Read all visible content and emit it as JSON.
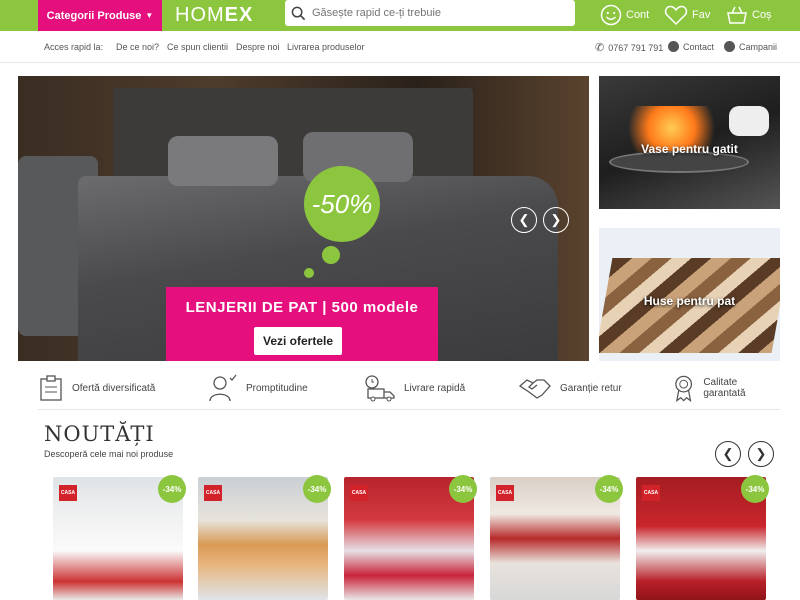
{
  "header": {
    "categories_label": "Categorii Produse",
    "logo_part1": "HOM",
    "logo_part2": "EX",
    "search_placeholder": "Găsește rapid ce-ți trebuie",
    "account_label": "Cont",
    "fav_label": "Fav",
    "cart_label": "Coș"
  },
  "quick": {
    "label": "Acces rapid la:",
    "links": [
      "De ce noi?",
      "Ce spun clientii",
      "Despre noi",
      "Livrarea produselor"
    ],
    "phone": "0767 791 791",
    "contact": "Contact",
    "campaigns": "Campanii"
  },
  "hero": {
    "discount": "-50%",
    "title": "LENJERII DE PAT | 500 modele",
    "cta": "Vezi ofertele"
  },
  "promos": [
    {
      "title": "Vase pentru gatit"
    },
    {
      "title": "Huse pentru pat"
    }
  ],
  "benefits": [
    "Ofertă diversificată",
    "Promptitudine",
    "Livrare rapidă",
    "Garanție retur",
    "Calitate garantată"
  ],
  "new_section": {
    "title": "NOUTĂȚI",
    "subtitle": "Descoperă cele mai noi produse"
  },
  "products": [
    {
      "discount": "-34%",
      "brand": "CASA"
    },
    {
      "discount": "-34%",
      "brand": "CASA"
    },
    {
      "discount": "-34%",
      "brand": "CASA"
    },
    {
      "discount": "-34%",
      "brand": "CASA"
    },
    {
      "discount": "-34%",
      "brand": "CASA"
    }
  ],
  "colors": {
    "brand_green": "#8cc63f",
    "brand_pink": "#e5107e"
  }
}
